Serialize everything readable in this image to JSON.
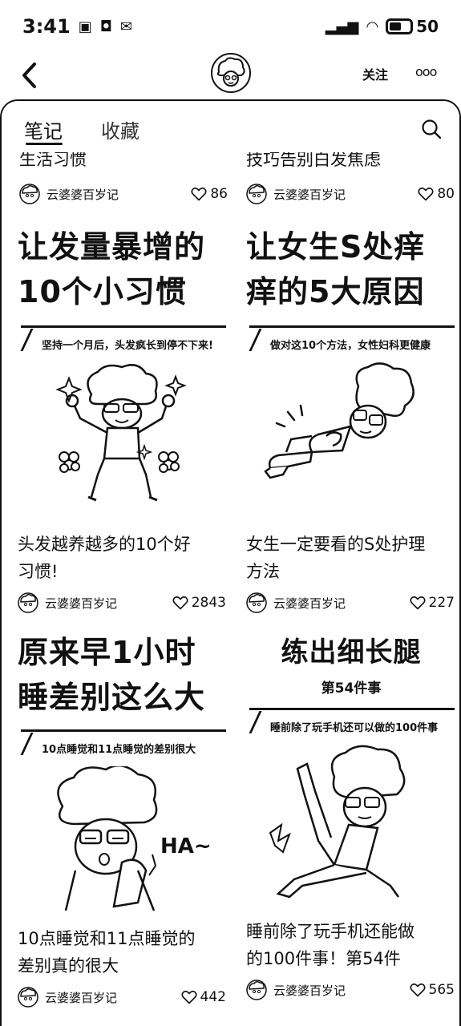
{
  "status_bar": {
    "time": "3:41",
    "battery": "50"
  },
  "header": {
    "follow_label": "关注",
    "more_label": "ooo"
  },
  "tabs": {
    "notes": "笔记",
    "favorites": "收藏"
  },
  "top_row": [
    {
      "title": "生活习惯",
      "author": "云婆婆百岁记",
      "likes": "86"
    },
    {
      "title": "技巧告别白发焦虑",
      "author": "云婆婆百岁记",
      "likes": "80"
    }
  ],
  "cards": [
    {
      "headline_1": "让发量暴增的",
      "headline_2": "10个小习惯",
      "subtitle": "坚持一个月后，头发疯长到停不下来!",
      "title_1": "头发越养越多的10个好",
      "title_2": "习惯!",
      "author": "云婆婆百岁记",
      "likes": "2843"
    },
    {
      "headline_1": "让女生S处痒",
      "headline_2": "痒的5大原因",
      "subtitle": "做对这10个方法，女性妇科更健康",
      "title_1": "女生一定要看的S处护理",
      "title_2": "方法",
      "author": "云婆婆百岁记",
      "likes": "227"
    },
    {
      "headline_1": "原来早1小时",
      "headline_2": "睡差别这么大",
      "subtitle": "10点睡觉和11点睡觉的差别很大",
      "art_text": "HA~",
      "title_1": "10点睡觉和11点睡觉的",
      "title_2": "差别真的很大",
      "author": "云婆婆百岁记",
      "likes": "442"
    },
    {
      "headline_1": "练出细长腿",
      "badge": "第54件事",
      "subtitle": "睡前除了玩手机还可以做的100件事",
      "title_1": "睡前除了玩手机还能做",
      "title_2": "的100件事！第54件",
      "author": "云婆婆百岁记",
      "likes": "565"
    }
  ]
}
